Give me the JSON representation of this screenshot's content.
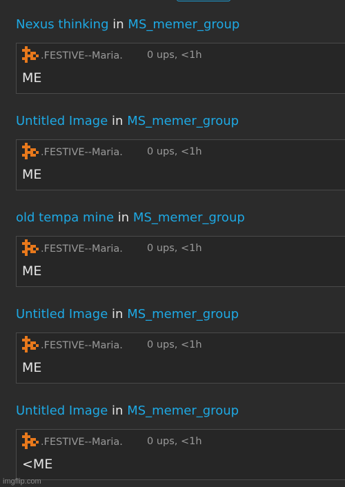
{
  "colors": {
    "background": "#2b2b2b",
    "link": "#1ea9e4",
    "avatar_orange": "#e8791c"
  },
  "entries": [
    {
      "title": "Nexus thinking",
      "in_word": "in",
      "group": "MS_memer_group",
      "avatar_icon": "festive-avatar-icon",
      "username": ".FESTIVE--Maria.",
      "meta": "0 ups, <1h",
      "text": "ME"
    },
    {
      "title": "Untitled Image",
      "in_word": "in",
      "group": "MS_memer_group",
      "avatar_icon": "festive-avatar-icon",
      "username": ".FESTIVE--Maria.",
      "meta": "0 ups, <1h",
      "text": "ME"
    },
    {
      "title": "old tempa mine",
      "in_word": "in",
      "group": "MS_memer_group",
      "avatar_icon": "festive-avatar-icon",
      "username": ".FESTIVE--Maria.",
      "meta": "0 ups, <1h",
      "text": "ME"
    },
    {
      "title": "Untitled Image",
      "in_word": "in",
      "group": "MS_memer_group",
      "avatar_icon": "festive-avatar-icon",
      "username": ".FESTIVE--Maria.",
      "meta": "0 ups, <1h",
      "text": "ME"
    },
    {
      "title": "Untitled Image",
      "in_word": "in",
      "group": "MS_memer_group",
      "avatar_icon": "festive-avatar-icon",
      "username": ".FESTIVE--Maria.",
      "meta": "0 ups, <1h",
      "text": "<ME"
    }
  ],
  "watermark": "imgflip.com"
}
